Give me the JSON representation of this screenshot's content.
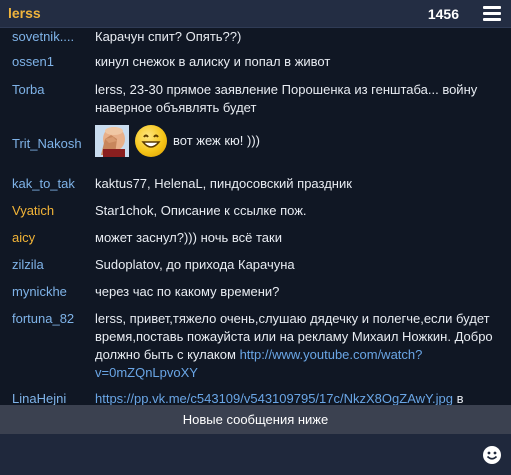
{
  "header": {
    "title": "lerss",
    "online_count": "1456",
    "menu_icon": "hamburger-menu-icon"
  },
  "messages": [
    {
      "nick": "sovetnik....",
      "text": "Карачун спит? Опять??)"
    },
    {
      "nick": "ossen1",
      "text": "кинул снежок в алиску и попал в живот"
    },
    {
      "nick": "Torba",
      "text": "lerss, 23-30 прямое заявление Порошенка из генштаба... войну наверное объявлять будет"
    },
    {
      "nick": "Trit_Nakosh",
      "text": "вот жеж кю! )))",
      "emojis": [
        "facepalm-emoji",
        "grin-smiley-emoji"
      ]
    },
    {
      "nick": "kak_to_tak",
      "text": "kaktus77, HelenaL, пиндосовский праздник"
    },
    {
      "nick": "Vyatich",
      "text": "Star1chok, Описание к ссылке пож."
    },
    {
      "nick": "aicy",
      "text": "может заснул?))) ночь всё таки"
    },
    {
      "nick": "zilzila",
      "text": "Sudoplatov, до прихода Карачуна"
    },
    {
      "nick": "mynickhe",
      "text": "через час по какому времени?"
    },
    {
      "nick": "fortuna_82",
      "text": "lerss, привет,тяжело очень,слушаю дядечку и полегче,если будет время,поставь пожауйста или на рекламу Михаил Ножкин. Добро должно быть с кулаком",
      "link": "http://www.youtube.com/watch?v=0mZQnLpvoXY"
    },
    {
      "nick": "LinaHejni",
      "link": "https://pp.vk.me/c543109/v543109795/17c/NkzX8OgZAwY.jpg",
      "text": "в"
    }
  ],
  "notice": "Новые сообщения ниже",
  "footer": {
    "smiley_icon": "smiley-icon"
  },
  "colors": {
    "background": "#101724",
    "nick_blue": "#7fb3e8",
    "nick_gold": "#f2b437",
    "link": "#6aa6e6",
    "header": "#232d43",
    "notice_bar": "#3b4150"
  }
}
